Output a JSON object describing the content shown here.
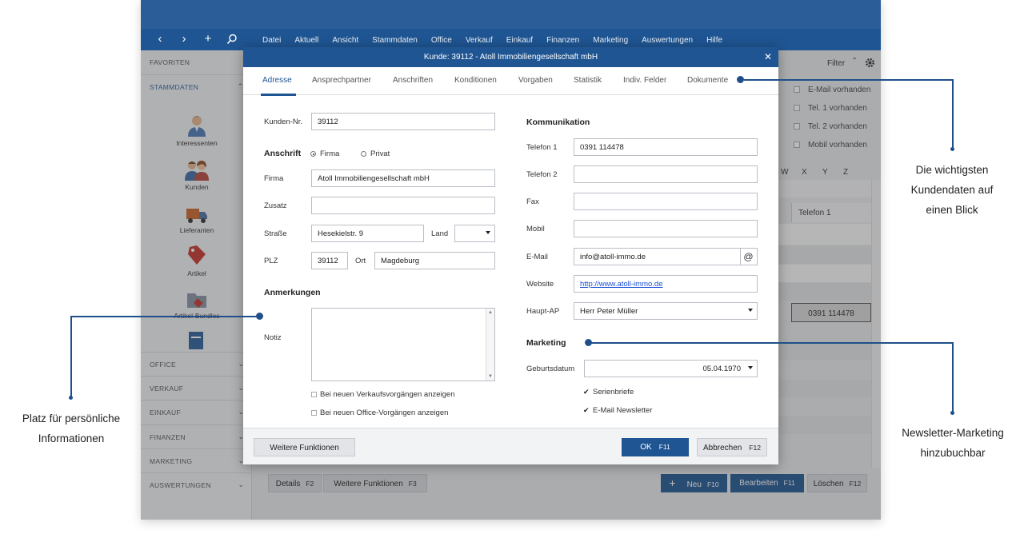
{
  "menu": [
    "Datei",
    "Aktuell",
    "Ansicht",
    "Stammdaten",
    "Office",
    "Verkauf",
    "Einkauf",
    "Finanzen",
    "Marketing",
    "Auswertungen",
    "Hilfe"
  ],
  "sidebar": {
    "favoriten": "FAVORITEN",
    "stammdaten": "STAMMDATEN",
    "items": [
      "Interessenten",
      "Kunden",
      "Lieferanten",
      "Artikel",
      "Artikel-Bundles"
    ],
    "bottom": [
      "OFFICE",
      "VERKAUF",
      "EINKAUF",
      "FINANZEN",
      "MARKETING",
      "AUSWERTUNGEN"
    ]
  },
  "background": {
    "filter": "Filter",
    "checks": [
      "E-Mail vorhanden",
      "Tel. 1 vorhanden",
      "Tel. 2 vorhanden",
      "Mobil vorhanden"
    ],
    "alphabet": [
      "W",
      "X",
      "Y",
      "Z"
    ],
    "telefon_header": "Telefon 1",
    "telefon_value": "0391 114478"
  },
  "bottom_bar": {
    "details": "Details",
    "details_key": "F2",
    "weitere": "Weitere Funktionen",
    "weitere_key": "F3",
    "neu": "Neu",
    "neu_key": "F10",
    "bearbeiten": "Bearbeiten",
    "bearbeiten_key": "F11",
    "loeschen": "Löschen",
    "loeschen_key": "F12"
  },
  "dialog": {
    "title": "Kunde: 39112 - Atoll Immobiliengesellschaft mbH",
    "tabs": [
      "Adresse",
      "Ansprechpartner",
      "Anschriften",
      "Konditionen",
      "Vorgaben",
      "Statistik",
      "Indiv. Felder",
      "Dokumente"
    ],
    "kunden_nr_label": "Kunden-Nr.",
    "kunden_nr": "39112",
    "anschrift_label": "Anschrift",
    "radio_firma": "Firma",
    "radio_privat": "Privat",
    "firma_label": "Firma",
    "firma": "Atoll Immobiliengesellschaft mbH",
    "zusatz_label": "Zusatz",
    "zusatz": "",
    "strasse_label": "Straße",
    "strasse": "Hesekielstr. 9",
    "land_label": "Land",
    "land": "",
    "plz_label": "PLZ",
    "plz": "39112",
    "ort_label": "Ort",
    "ort": "Magdeburg",
    "anmerkungen_label": "Anmerkungen",
    "notiz_label": "Notiz",
    "cb_verkauf": "Bei neuen Verkaufsvorgängen anzeigen",
    "cb_office": "Bei neuen Office-Vorgängen anzeigen",
    "kommunikation_label": "Kommunikation",
    "telefon1_label": "Telefon 1",
    "telefon1": "0391 114478",
    "telefon2_label": "Telefon 2",
    "telefon2": "",
    "fax_label": "Fax",
    "fax": "",
    "mobil_label": "Mobil",
    "mobil": "",
    "email_label": "E-Mail",
    "email": "info@atoll-immo.de",
    "at_symbol": "@",
    "website_label": "Website",
    "website": "http://www.atoll-immo.de",
    "haupt_ap_label": "Haupt-AP",
    "haupt_ap": "Herr Peter Müller",
    "marketing_label": "Marketing",
    "geburtsdatum_label": "Geburtsdatum",
    "geburtsdatum": "05.04.1970",
    "cb_serienbriefe": "Serienbriefe",
    "cb_newsletter": "E-Mail Newsletter",
    "weitere_funktionen": "Weitere Funktionen",
    "ok": "OK",
    "ok_key": "F11",
    "abbrechen": "Abbrechen",
    "abbrechen_key": "F12"
  },
  "annotations": {
    "right_top": [
      "Die wichtigsten",
      "Kundendaten auf",
      "einen Blick"
    ],
    "left": [
      "Platz für persönliche",
      "Informationen"
    ],
    "right_bottom": [
      "Newsletter-Marketing",
      "hinzubuchbar"
    ]
  },
  "colors": {
    "brand_blue": "#1f5592",
    "annotation_blue": "#1f4f8a"
  }
}
